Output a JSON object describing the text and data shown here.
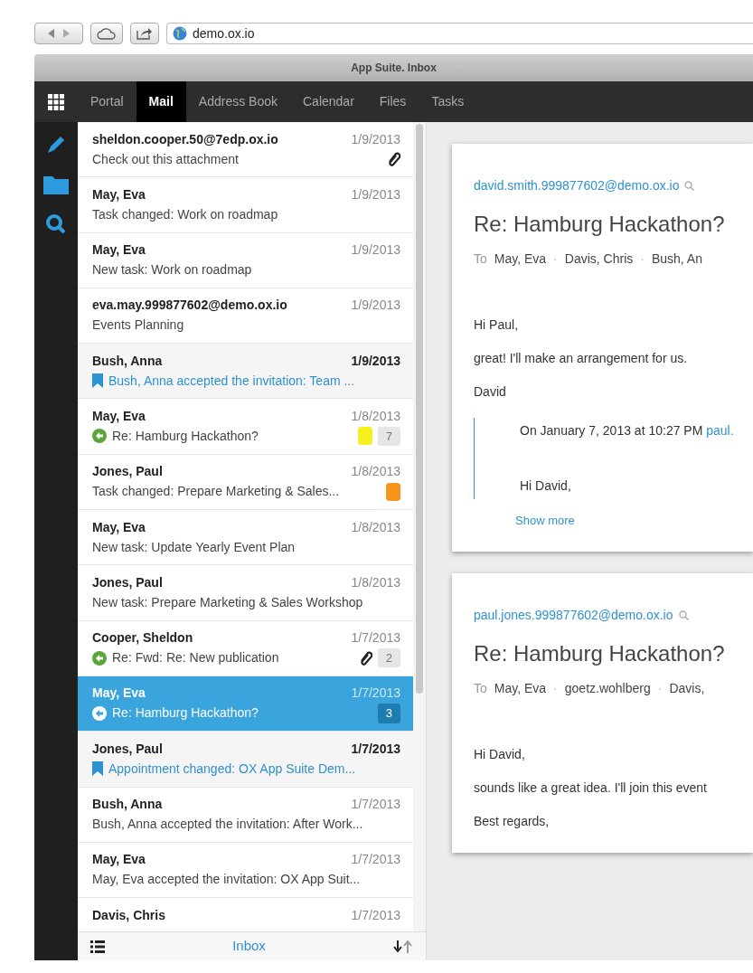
{
  "browser": {
    "url": "demo.ox.io",
    "title": "App Suite. Inbox"
  },
  "apps": [
    {
      "label": "Portal",
      "selected": false
    },
    {
      "label": "Mail",
      "selected": true
    },
    {
      "label": "Address Book",
      "selected": false
    },
    {
      "label": "Calendar",
      "selected": false
    },
    {
      "label": "Files",
      "selected": false
    },
    {
      "label": "Tasks",
      "selected": false
    }
  ],
  "mails": [
    {
      "from": "sheldon.cooper.50@7edp.ox.io",
      "date": "1/9/2013",
      "subject": "Check out this attachment",
      "unread": false,
      "replied": false,
      "attachment": true,
      "selected": false
    },
    {
      "from": "May, Eva",
      "date": "1/9/2013",
      "subject": "Task changed: Work on roadmap",
      "unread": false,
      "replied": false,
      "attachment": false,
      "selected": false
    },
    {
      "from": "May, Eva",
      "date": "1/9/2013",
      "subject": "New task: Work on roadmap",
      "unread": false,
      "replied": false,
      "attachment": false,
      "selected": false
    },
    {
      "from": "eva.may.999877602@demo.ox.io",
      "date": "1/9/2013",
      "subject": "Events Planning",
      "unread": false,
      "replied": false,
      "attachment": false,
      "selected": false
    },
    {
      "from": "Bush, Anna",
      "date": "1/9/2013",
      "subject": "Bush, Anna accepted the invitation: Team ...",
      "unread": true,
      "replied": false,
      "attachment": false,
      "selected": false
    },
    {
      "from": "May, Eva",
      "date": "1/8/2013",
      "subject": "Re: Hamburg Hackathon?",
      "unread": false,
      "replied": true,
      "attachment": false,
      "color": "#f5f01e",
      "thread_count": "7",
      "selected": false
    },
    {
      "from": "Jones, Paul",
      "date": "1/8/2013",
      "subject": "Task changed: Prepare Marketing & Sales...",
      "unread": false,
      "replied": false,
      "attachment": false,
      "color": "#f7941d",
      "selected": false
    },
    {
      "from": "May, Eva",
      "date": "1/8/2013",
      "subject": "New task: Update Yearly Event Plan",
      "unread": false,
      "replied": false,
      "attachment": false,
      "selected": false
    },
    {
      "from": "Jones, Paul",
      "date": "1/8/2013",
      "subject": "New task: Prepare Marketing & Sales Workshop",
      "unread": false,
      "replied": false,
      "attachment": false,
      "selected": false
    },
    {
      "from": "Cooper, Sheldon",
      "date": "1/7/2013",
      "subject": "Re: Fwd: Re: New publication",
      "unread": false,
      "replied": true,
      "attachment": true,
      "thread_count": "2",
      "selected": false
    },
    {
      "from": "May, Eva",
      "date": "1/7/2013",
      "subject": "Re: Hamburg Hackathon?",
      "unread": false,
      "replied": true,
      "attachment": false,
      "thread_count": "3",
      "selected": true
    },
    {
      "from": "Jones, Paul",
      "date": "1/7/2013",
      "subject": "Appointment changed: OX App Suite Dem...",
      "unread": true,
      "replied": false,
      "attachment": false,
      "selected": false
    },
    {
      "from": "Bush, Anna",
      "date": "1/7/2013",
      "subject": "Bush, Anna accepted the invitation: After Work...",
      "unread": false,
      "replied": false,
      "attachment": false,
      "selected": false
    },
    {
      "from": "May, Eva",
      "date": "1/7/2013",
      "subject": "May, Eva accepted the invitation: OX App Suit...",
      "unread": false,
      "replied": false,
      "attachment": false,
      "selected": false
    },
    {
      "from": "Davis, Chris",
      "date": "1/7/2013",
      "unread": false,
      "replied": false,
      "attachment": false,
      "selected": false
    }
  ],
  "list_footer": {
    "folder": "Inbox"
  },
  "thread": [
    {
      "sender": "david.smith.999877602@demo.ox.io",
      "subject": "Re: Hamburg Hackathon?",
      "to_label": "To",
      "separator": "·",
      "recipients": [
        "May, Eva",
        "Davis, Chris",
        "Bush, An"
      ],
      "body": [
        "Hi Paul,",
        "great! I'll make an arrangement for us.",
        "David"
      ],
      "quote": {
        "intro": "On January 7, 2013 at 10:27 PM",
        "link": "paul.",
        "text": "Hi David,",
        "more": "Show more"
      }
    },
    {
      "sender": "paul.jones.999877602@demo.ox.io",
      "subject": "Re: Hamburg Hackathon?",
      "to_label": "To",
      "separator": "·",
      "recipients": [
        "May, Eva",
        "goetz.wohlberg",
        "Davis,"
      ],
      "body": [
        "Hi David,",
        "sounds like a great idea. I'll join this event",
        "Best regards,"
      ]
    }
  ]
}
